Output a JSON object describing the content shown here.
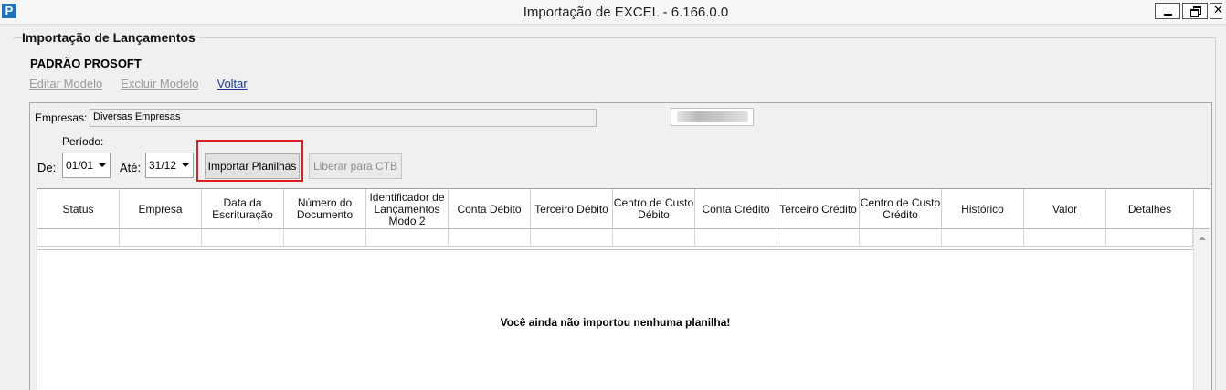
{
  "window": {
    "title": "Importação de EXCEL - 6.166.0.0",
    "logo_letter": "P",
    "close_glyph": "✕"
  },
  "group": {
    "title": "Importação de Lançamentos"
  },
  "model": {
    "name": "PADRÃO PROSOFT",
    "links": [
      "Editar Modelo",
      "Excluir Modelo",
      "Voltar"
    ]
  },
  "form": {
    "empresas_label": "Empresas:",
    "empresas_value": "Diversas Empresas",
    "periodo_label": "Período:",
    "de_label": "De:",
    "de_value": "01/01",
    "ate_label": "Até:",
    "ate_value": "31/12",
    "import_button": "Importar Planilhas",
    "liberar_button": "Liberar para CTB"
  },
  "grid": {
    "columns": [
      "Status",
      "Empresa",
      "Data da Escrituração",
      "Número do Documento",
      "Identificador de Lançamentos Modo 2",
      "Conta Débito",
      "Terceiro Débito",
      "Centro de Custo Débito",
      "Conta Crédito",
      "Terceiro Crédito",
      "Centro de Custo Crédito",
      "Histórico",
      "Valor",
      "Detalhes"
    ],
    "empty_message": "Você ainda não importou nenhuma planilha!"
  }
}
